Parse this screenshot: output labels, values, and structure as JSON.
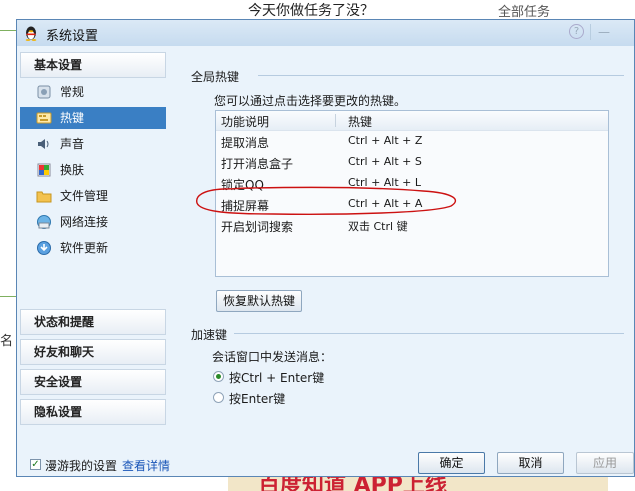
{
  "background_page": {
    "headline": "今天你做任务了没？",
    "link": "全部任务",
    "side_text": "名",
    "ad_text": "百度知道 APP上线"
  },
  "window": {
    "title": "系统设置",
    "help": "?",
    "minimize": "—"
  },
  "sidebar": {
    "sections": [
      {
        "label": "基本设置"
      },
      {
        "label": "状态和提醒"
      },
      {
        "label": "好友和聊天"
      },
      {
        "label": "安全设置"
      },
      {
        "label": "隐私设置"
      }
    ],
    "items": [
      {
        "label": "常规",
        "icon": "general-icon"
      },
      {
        "label": "热键",
        "icon": "hotkey-icon",
        "selected": true
      },
      {
        "label": "声音",
        "icon": "sound-icon"
      },
      {
        "label": "换肤",
        "icon": "skin-icon"
      },
      {
        "label": "文件管理",
        "icon": "folder-icon"
      },
      {
        "label": "网络连接",
        "icon": "network-icon"
      },
      {
        "label": "软件更新",
        "icon": "update-icon"
      }
    ]
  },
  "hotkeys": {
    "group_title": "全局热键",
    "description": "您可以通过点击选择要更改的热键。",
    "columns": [
      "功能说明",
      "热键"
    ],
    "rows": [
      {
        "func": "提取消息",
        "key": "Ctrl + Alt + Z"
      },
      {
        "func": "打开消息盒子",
        "key": "Ctrl + Alt + S"
      },
      {
        "func": "锁定QQ",
        "key": "Ctrl + Alt + L"
      },
      {
        "func": "捕捉屏幕",
        "key": "Ctrl + Alt + A"
      },
      {
        "func": "开启划词搜索",
        "key": "双击 Ctrl 键"
      }
    ],
    "restore_button": "恢复默认热键"
  },
  "accelerator": {
    "group_title": "加速键",
    "prompt": "会话窗口中发送消息：",
    "options": [
      {
        "label": "按Ctrl + Enter键",
        "selected": true
      },
      {
        "label": "按Enter键",
        "selected": false
      }
    ]
  },
  "footer": {
    "roaming_label": "漫游我的设置",
    "roaming_checked": true,
    "details_link": "查看详情",
    "ok": "确定",
    "cancel": "取消",
    "apply": "应用"
  },
  "colors": {
    "selected_bg": "#3a7fc4",
    "annotation": "#cc1111",
    "link": "#1a56b8"
  }
}
